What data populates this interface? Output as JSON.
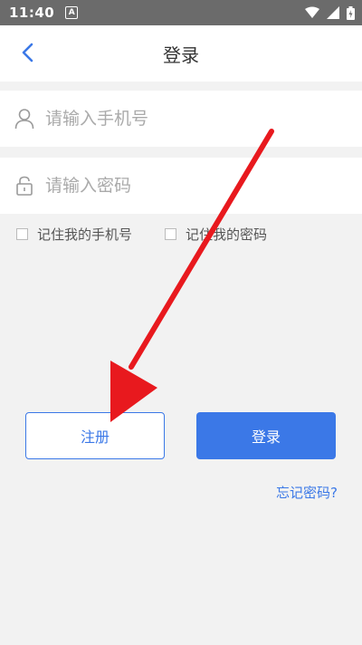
{
  "status_bar": {
    "time": "11:40",
    "notification_icon": "A"
  },
  "header": {
    "title": "登录",
    "back_icon": "chevron-left"
  },
  "form": {
    "phone_placeholder": "请输入手机号",
    "password_placeholder": "请输入密码",
    "remember_phone_label": "记住我的手机号",
    "remember_password_label": "记住我的密码"
  },
  "buttons": {
    "register_label": "注册",
    "login_label": "登录"
  },
  "forgot_label": "忘记密码?",
  "colors": {
    "accent": "#3b78e7",
    "annotation_arrow": "#e8191e",
    "background": "#f2f2f2"
  }
}
